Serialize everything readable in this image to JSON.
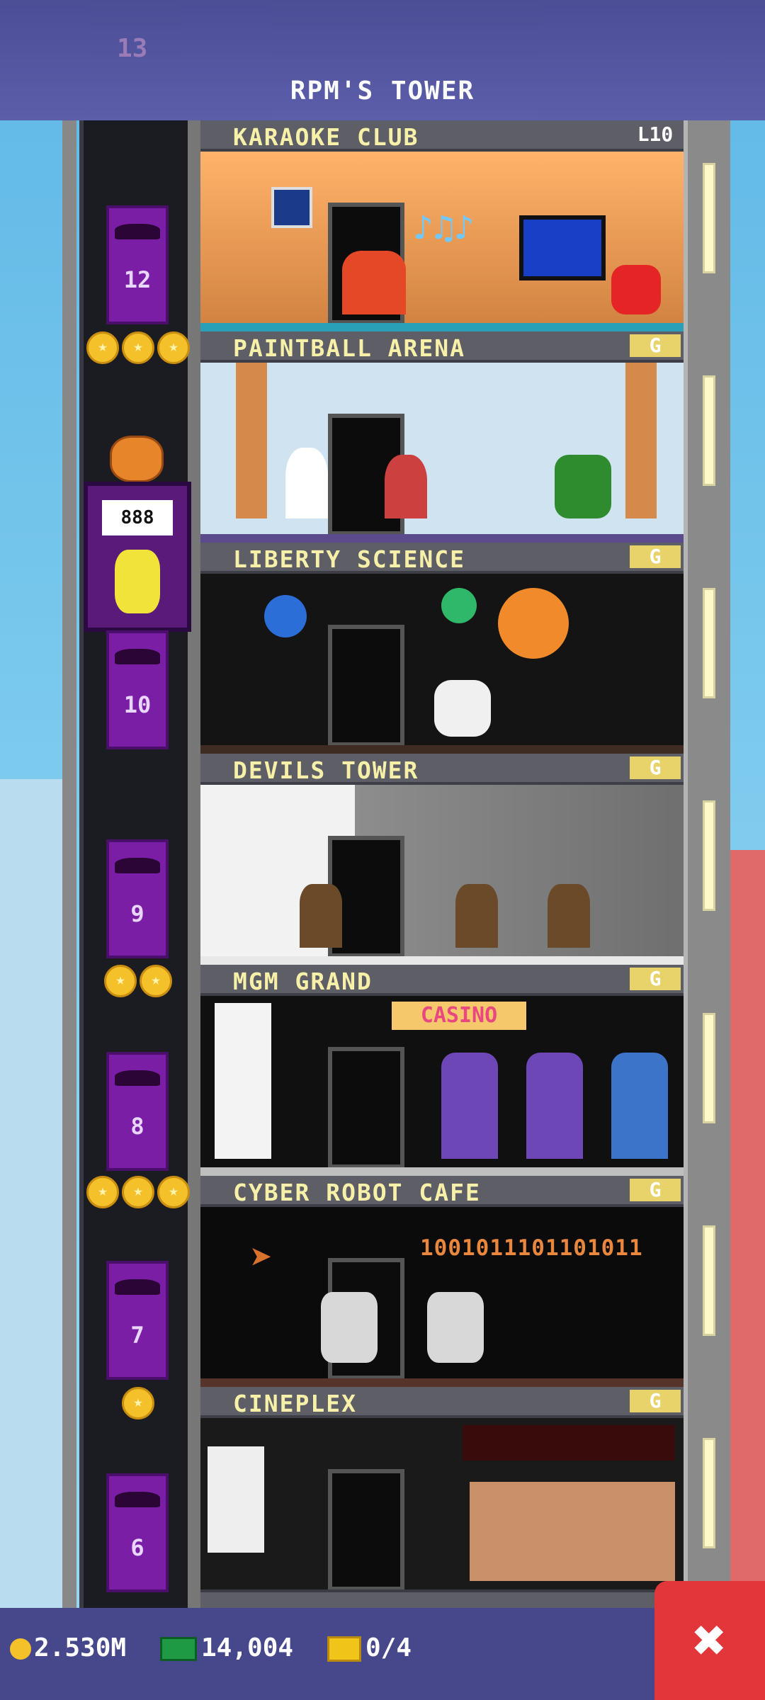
{
  "header": {
    "title": "RPM'S TOWER",
    "top_floor_ghost": "13"
  },
  "floors": [
    {
      "name": "KARAOKE CLUB",
      "badge": "L10",
      "elevator_number": "12",
      "coins": 0
    },
    {
      "name": "PAINTBALL ARENA",
      "badge": "G",
      "elevator_number": "",
      "coins": 3
    },
    {
      "name": "LIBERTY SCIENCE",
      "badge": "G",
      "elevator_number": "10",
      "coins": 0
    },
    {
      "name": "DEVILS TOWER",
      "badge": "G",
      "elevator_number": "9",
      "coins": 0
    },
    {
      "name": "MGM GRAND",
      "badge": "G",
      "elevator_number": "8",
      "coins": 2
    },
    {
      "name": "CYBER ROBOT CAFE",
      "badge": "G",
      "elevator_number": "7",
      "coins": 3
    },
    {
      "name": "CINEPLEX",
      "badge": "G",
      "elevator_number": "6",
      "coins": 1
    }
  ],
  "scene_text": {
    "casino_sign": "CASINO",
    "binary": "1001011101101011",
    "elevator_display": "888"
  },
  "status_bar": {
    "coins": "2.530M",
    "bux": "14,004",
    "tickets": "0/4",
    "close_label": "✖"
  }
}
